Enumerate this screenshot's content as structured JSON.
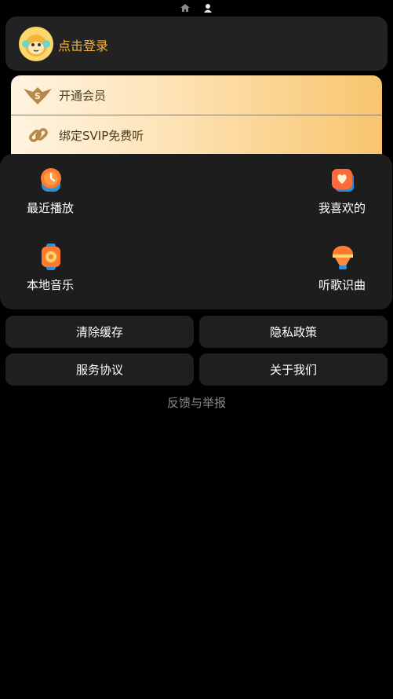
{
  "topbar": {
    "home_icon": "home-icon",
    "user_icon": "user-icon"
  },
  "login": {
    "label": "点击登录",
    "avatar_icon": "monkey-avatar-icon",
    "accent": "#f7b339"
  },
  "vip": {
    "rows": [
      {
        "label": "开通会员",
        "icon": "svip-badge-icon"
      },
      {
        "label": "绑定SVIP免费听",
        "icon": "link-icon"
      }
    ]
  },
  "shortcuts": [
    {
      "label": "最近播放",
      "icon": "clock-icon"
    },
    {
      "label": "我喜欢的",
      "icon": "heart-icon"
    },
    {
      "label": "本地音乐",
      "icon": "local-music-icon"
    },
    {
      "label": "听歌识曲",
      "icon": "recognize-song-icon"
    }
  ],
  "buttons": {
    "clear_cache": "清除缓存",
    "privacy": "隐私政策",
    "service": "服务协议",
    "about": "关于我们"
  },
  "feedback": "反馈与举报"
}
